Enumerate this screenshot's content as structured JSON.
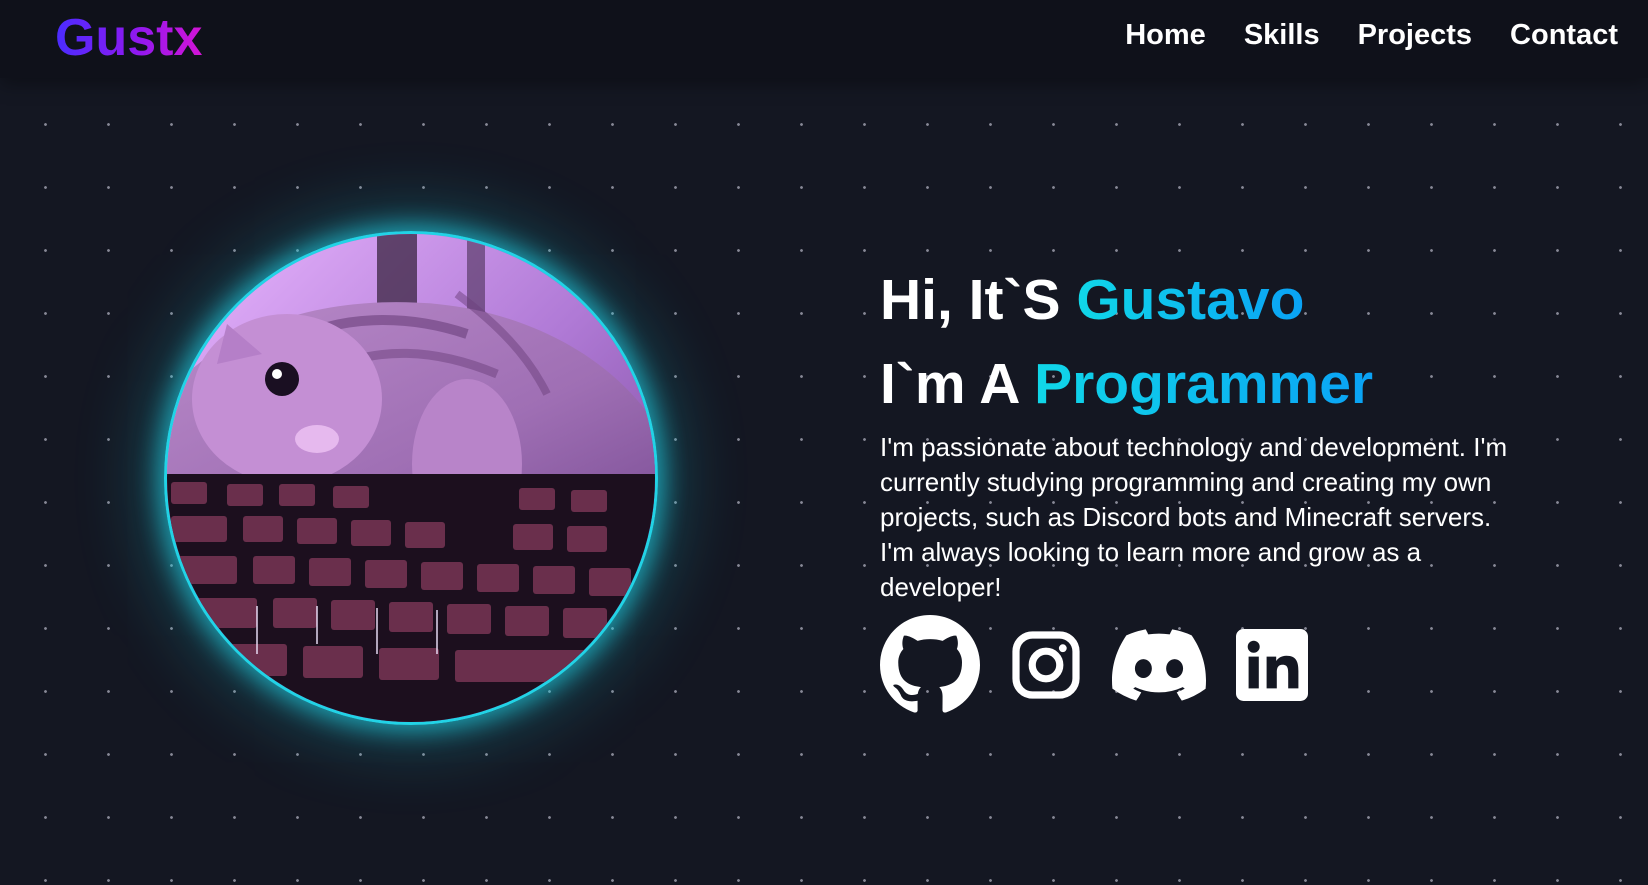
{
  "brand": {
    "logo": "Gustx"
  },
  "nav": {
    "items": [
      {
        "label": "Home"
      },
      {
        "label": "Skills"
      },
      {
        "label": "Projects"
      },
      {
        "label": "Contact"
      }
    ]
  },
  "hero": {
    "line1_prefix": "Hi, It`S ",
    "line1_name": "Gustavo",
    "line2_prefix": "I`m A ",
    "line2_role": "Programmer",
    "bio": "I'm passionate about technology and development. I'm currently studying programming and creating my own projects, such as Discord bots and Minecraft servers. I'm always looking to learn more and grow as a developer!"
  },
  "socials": [
    {
      "icon": "github-icon"
    },
    {
      "icon": "instagram-icon"
    },
    {
      "icon": "discord-icon"
    },
    {
      "icon": "linkedin-icon"
    }
  ],
  "colors": {
    "background": "#141722",
    "header": "#0f111a",
    "accent_cyan": "#10d7e8",
    "accent_blue": "#0aa2f5",
    "logo_gradient_start": "#4a2cff",
    "logo_gradient_end": "#d314d6"
  }
}
